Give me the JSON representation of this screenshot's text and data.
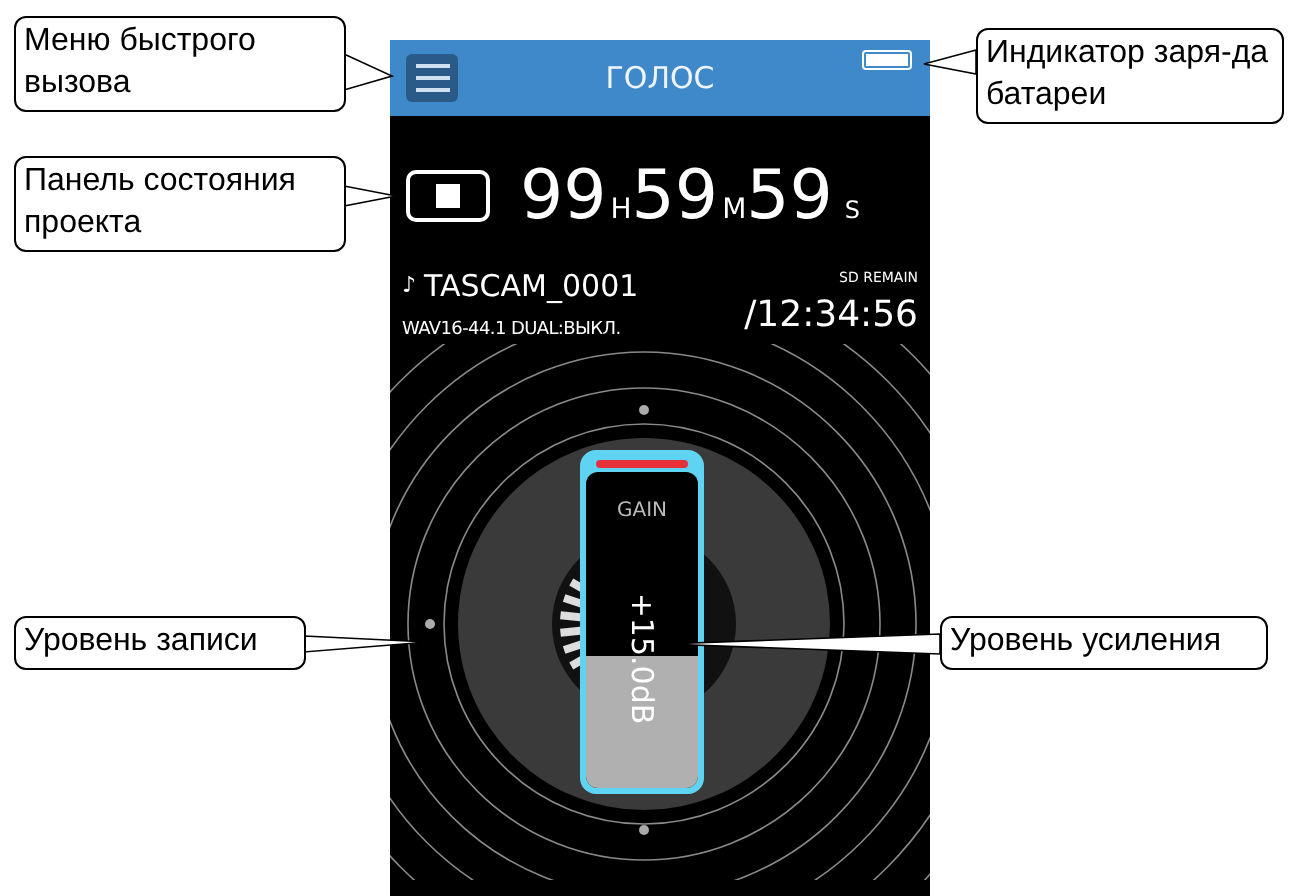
{
  "header": {
    "title": "ГОЛОС"
  },
  "status": {
    "hours": "99",
    "hours_unit": "H",
    "minutes": "59",
    "minutes_unit": "M",
    "seconds": "59",
    "seconds_unit": "S"
  },
  "file": {
    "note": "♪",
    "name": "TASCAM_0001",
    "format": "WAV16-44.1 DUAL:ВЫКЛ.",
    "remain_label": "SD REMAIN",
    "remain_time": "/12:34:56"
  },
  "gain": {
    "label": "GAIN",
    "value": "+15.0dB",
    "level": 0.42
  },
  "callouts": [
    {
      "text": "Меню быстрого вызова"
    },
    {
      "text": "Панель состояния проекта"
    },
    {
      "text": "Уровень записи"
    },
    {
      "text": "Индикатор заря-да батареи"
    },
    {
      "text": "Уровень усиления"
    }
  ]
}
